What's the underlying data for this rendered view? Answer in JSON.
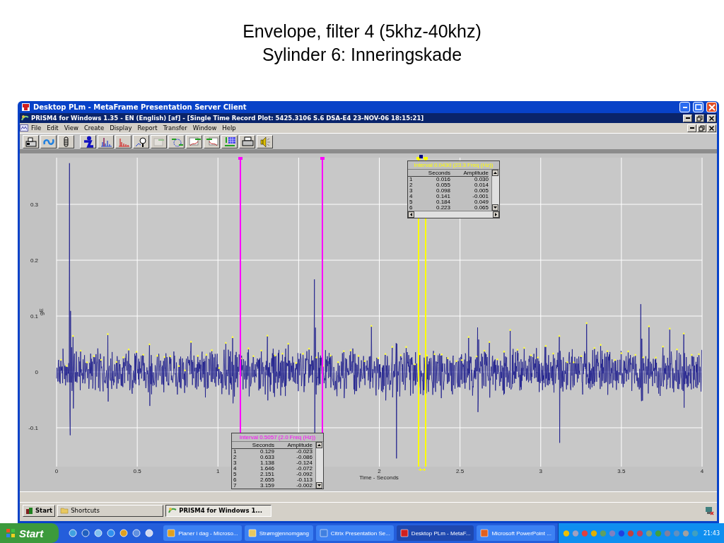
{
  "slide": {
    "title_lines": [
      "Envelope, filter 4 (5khz-40khz)",
      "Sylinder 6: Inneringskade"
    ]
  },
  "citrix_window": {
    "title": "Desktop PLm - MetaFrame Presentation Server Client"
  },
  "app_window": {
    "title": "PRISM4 for Windows 1.35 - EN (English) [af] - [Single Time Record Plot: 5425.3106 S.6 DSA-E4 23-NOV-06 18:15:21]"
  },
  "menu": [
    "File",
    "Edit",
    "View",
    "Create",
    "Display",
    "Report",
    "Transfer",
    "Window",
    "Help"
  ],
  "toolbar": [
    {
      "disabled": false
    },
    {
      "disabled": false
    },
    {
      "disabled": false
    },
    {
      "disabled": false
    },
    {
      "disabled": false
    },
    {
      "disabled": false
    },
    {
      "disabled": false
    },
    {
      "disabled": true
    },
    {
      "disabled": false
    },
    {
      "disabled": false
    },
    {
      "disabled": false
    },
    {
      "disabled": false
    },
    {
      "disabled": false
    },
    {
      "disabled": false
    }
  ],
  "plot": {
    "ylabel": "gE",
    "xlabel": "Time - Seconds",
    "yticks": [
      "0.3",
      "0.2",
      "0.1",
      "0",
      "-0.1"
    ],
    "xticks": [
      "0",
      "0.5",
      "1",
      "2",
      "2.5",
      "3",
      "3.5",
      "4"
    ]
  },
  "cursor_tables": [
    {
      "title": "Interval 0.0430 (23.3 Freq (Hz))",
      "color": "#ffff00",
      "columns": [
        "",
        "Seconds",
        "Amplitude"
      ],
      "rows": [
        [
          "1",
          "0.016",
          "0.030"
        ],
        [
          "2",
          "0.055",
          "0.014"
        ],
        [
          "3",
          "0.098",
          "0.005"
        ],
        [
          "4",
          "0.141",
          "-0.001"
        ],
        [
          "5",
          "0.184",
          "0.049"
        ],
        [
          "6",
          "0.223",
          "0.065"
        ]
      ]
    },
    {
      "title": "Interval 0.5057  (2.0  Freq (Hz))",
      "color": "#ff00ff",
      "columns": [
        "",
        "Seconds",
        "Amplitude"
      ],
      "rows": [
        [
          "1",
          "0.129",
          "-0.023"
        ],
        [
          "2",
          "0.633",
          "-0.086"
        ],
        [
          "3",
          "1.138",
          "-0.124"
        ],
        [
          "4",
          "1.646",
          "-0.072"
        ],
        [
          "5",
          "2.151",
          "-0.092"
        ],
        [
          "6",
          "2.655",
          "-0.113"
        ],
        [
          "7",
          "3.159",
          "-0.002"
        ]
      ]
    }
  ],
  "citrix_taskbar": {
    "start": "Start",
    "items": [
      {
        "label": "Shortcuts",
        "selected": false
      },
      {
        "label": "PRISM4 for Windows 1...",
        "selected": true
      }
    ]
  },
  "taskbar": {
    "start": "Start",
    "tasks": [
      {
        "label": "Planer i dag - Microso...",
        "selected": false
      },
      {
        "label": "Strømgjennomgang",
        "selected": false
      },
      {
        "label": "Citrix Presentation Se...",
        "selected": false
      },
      {
        "label": "Desktop PLm - MetaF...",
        "selected": true
      },
      {
        "label": "Microsoft PowerPoint ...",
        "selected": false
      }
    ],
    "clock": "21:43"
  }
}
